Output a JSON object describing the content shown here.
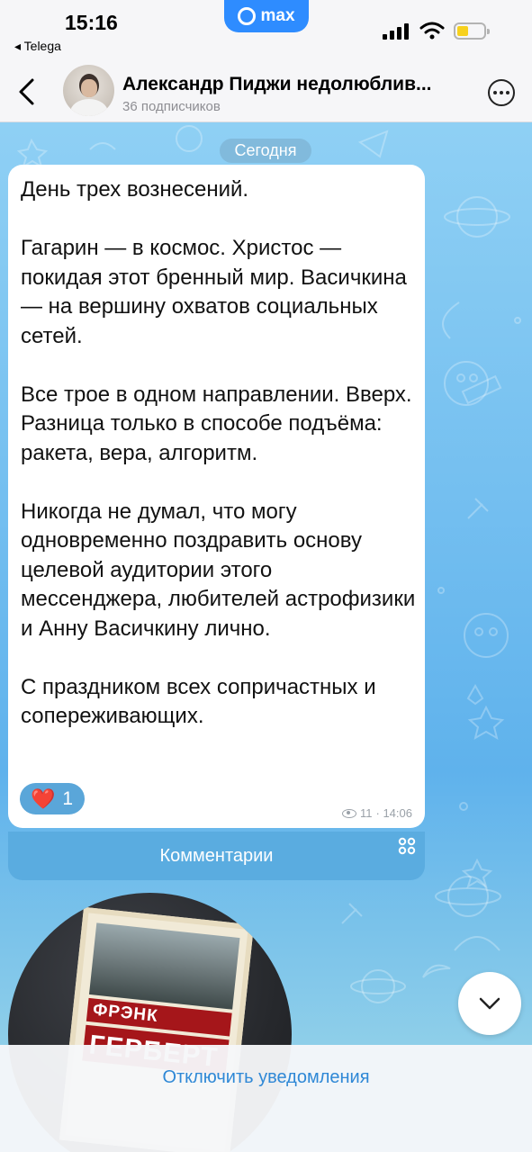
{
  "status_bar": {
    "time": "15:16",
    "back_app": "◂ Telega",
    "max_badge": "max",
    "battery_color": "#f7d11e"
  },
  "header": {
    "title": "Александр Пиджи недолюблив...",
    "subtitle": "36 подписчиков",
    "back_icon": "chevron-left-icon",
    "more_icon": "more-icon"
  },
  "chat": {
    "date_label": "Сегодня",
    "message": {
      "paragraphs": [
        "День трех вознесений.",
        "Гагарин — в космос. Христос — покидая этот бренный мир. Васичкина — на вершину охватов социальных сетей.",
        "Все трое в одном направлении. Вверх. Разница только в способе подъёма: ракета, вера, алгоритм.",
        "Никогда не думал, что могу одновременно поздравить основу целевой аудитории этого мессенджера, любителей астрофизики и Анну Васичкину лично.",
        "С праздником всех сопричастных и сопереживающих."
      ],
      "reaction_emoji": "❤️",
      "reaction_count": "1",
      "views": "11",
      "time": "· 14:06"
    },
    "comments_label": "Комментарии",
    "video_note": {
      "book_brand": "ФРЭНК",
      "book_author": "ГЕРБЕРТ"
    }
  },
  "footer": {
    "mute_label": "Отключить уведомления"
  },
  "colors": {
    "accent": "#2f88d6",
    "comments_bg": "#5aace0",
    "reaction_bg": "#5aa6d9"
  }
}
